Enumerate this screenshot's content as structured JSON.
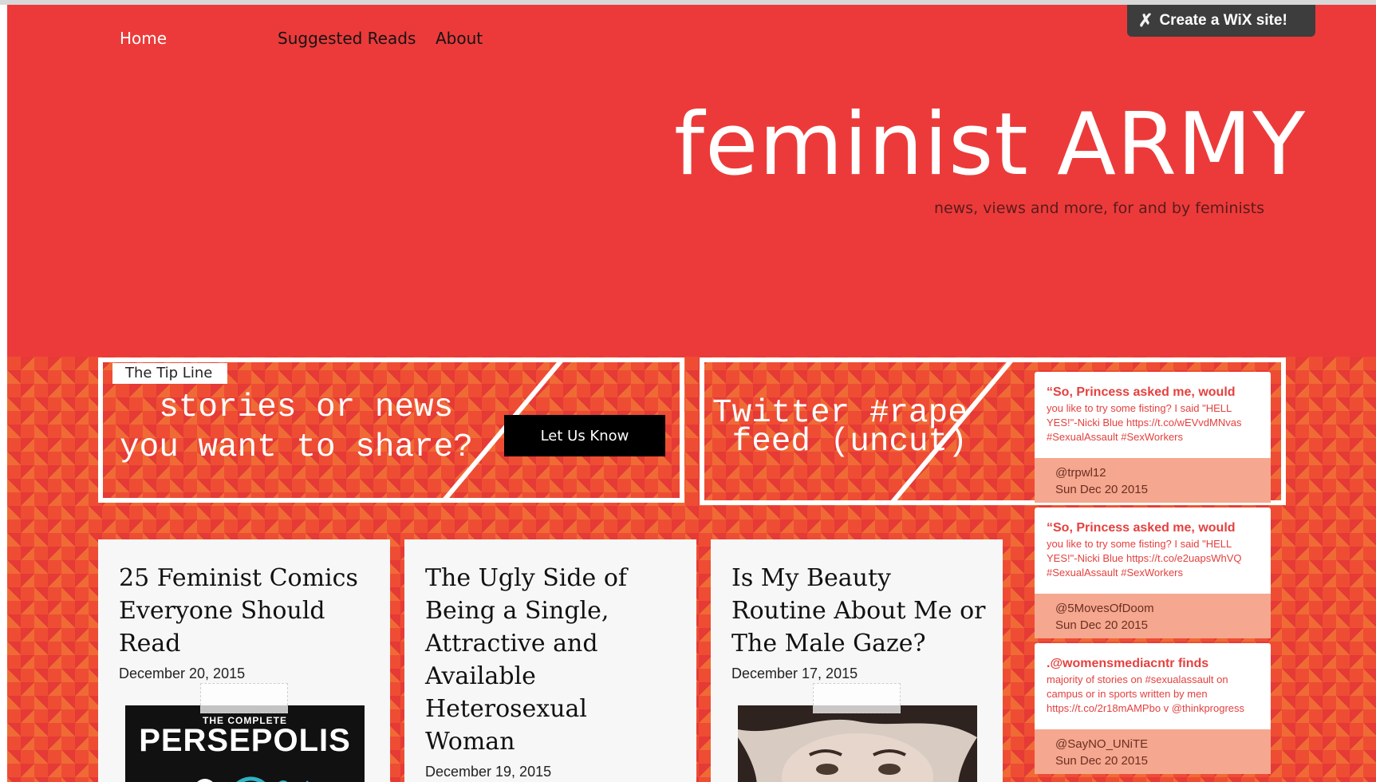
{
  "nav": {
    "home": "Home",
    "suggested_reads": "Suggested Reads",
    "about": "About"
  },
  "wix_banner": {
    "label": "Create a WiX site!",
    "icon": "wix-x-icon"
  },
  "header": {
    "title": "feminist ARMY",
    "subtitle": "news, views and more, for and by feminists"
  },
  "tip_line": {
    "label": "The Tip Line",
    "text": "  stories or news\nyou want to share?",
    "button": "Let Us Know"
  },
  "twitter_feed": {
    "heading": "Twitter #rape\n feed (uncut)",
    "tweets": [
      {
        "headline": "“So, Princess asked me, would",
        "body": "you like to try some fisting? I said \"HELL YES!\"-Nicki Blue https://t.co/wEVvdMNvas #SexualAssault #SexWorkers",
        "handle": "@trpwl12",
        "date": "Sun Dec 20 2015"
      },
      {
        "headline": "“So, Princess asked me, would",
        "body": "you like to try some fisting? I said \"HELL YES!\"-Nicki Blue https://t.co/e2uapsWhVQ #SexualAssault #SexWorkers",
        "handle": "@5MovesOfDoom",
        "date": "Sun Dec 20 2015"
      },
      {
        "headline": ".@womensmediacntr finds",
        "body": "majority of stories on #sexualassault on campus or in sports written by men https://t.co/2r18mAMPbo v @thinkprogress",
        "handle": "@SayNO_UNiTE",
        "date": "Sun Dec 20 2015"
      }
    ]
  },
  "posts": [
    {
      "title": "25 Feminist Comics Everyone Should Read",
      "date": "December 20, 2015",
      "image_small": "THE COMPLETE",
      "image_big": "PERSEPOLIS"
    },
    {
      "title": "The Ugly Side of Being a Single, Attractive and Available Heterosexual Woman",
      "date": "December 19, 2015"
    },
    {
      "title": "Is My Beauty Routine About Me or The Male Gaze?",
      "date": "December 17, 2015"
    }
  ],
  "colors": {
    "header_red": "#ec3a3a",
    "pattern_orange": "#f06a35",
    "tweet_meta": "#f5a78f",
    "wix_bar": "#3d3d3d"
  }
}
